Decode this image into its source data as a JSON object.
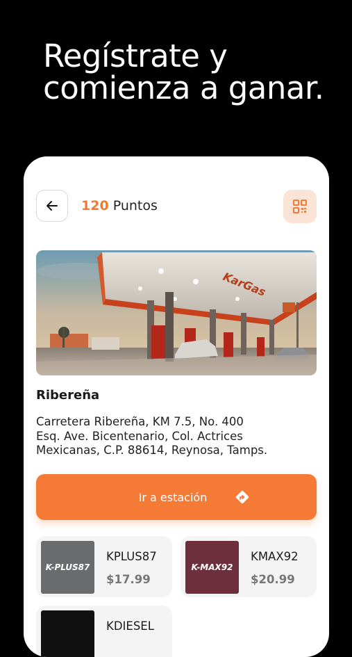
{
  "headline": {
    "line1": "Regístrate y",
    "line2": "comienza a ganar."
  },
  "header": {
    "points_value": "120",
    "points_label": "Puntos",
    "back_icon": "arrow-left-icon",
    "qr_icon": "qr-code-icon"
  },
  "station": {
    "name": "Ribereña",
    "address_lines": [
      "Carretera Ribereña, KM 7.5, No. 400",
      "Esq. Ave. Bicentenario, Col. Actrices",
      "Mexicanas, C.P. 88614, Reynosa, Tamps."
    ],
    "sign_text": "KarGas"
  },
  "action": {
    "go_label": "Ir a estación",
    "icon": "directions-icon"
  },
  "fuels": [
    {
      "brand": "K-PLUS87",
      "name": "KPLUS87",
      "price": "$17.99",
      "color": "#6a6b6d"
    },
    {
      "brand": "K-MAX92",
      "name": "KMAX92",
      "price": "$20.99",
      "color": "#6e2f3c"
    },
    {
      "brand": "",
      "name": "KDIESEL",
      "price": "",
      "color": "#111111"
    }
  ],
  "colors": {
    "accent": "#f57a35",
    "accent_light": "#fbe3d6",
    "background": "#000000"
  }
}
